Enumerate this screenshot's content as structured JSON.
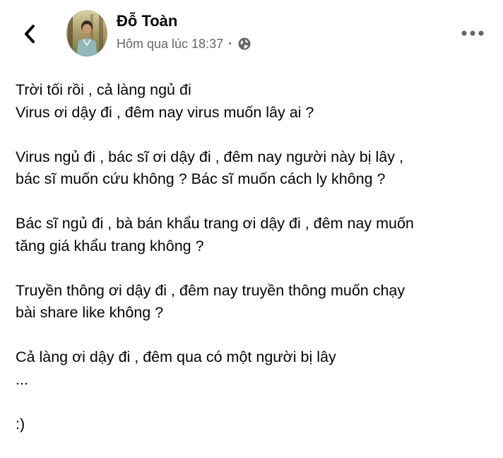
{
  "post": {
    "author": "Đỗ Toàn",
    "timestamp": "Hôm qua lúc 18:37",
    "separator": "·",
    "privacy_icon": "globe-icon",
    "back_icon": "chevron-left-icon",
    "more_icon": "more-horizontal-icon"
  },
  "body": {
    "p1": [
      "Trời tối rồi , cả làng ngủ đi",
      "Virus ơi dậy đi , đêm nay virus muốn lây ai ?"
    ],
    "p2": [
      "Virus ngủ đi , bác sĩ ơi dậy đi , đêm nay người này bị lây ,",
      "bác sĩ muốn cứu không ? Bác sĩ muốn cách ly không ?"
    ],
    "p3": [
      "Bác sĩ ngủ đi , bà bán khẩu trang ơi dậy đi , đêm nay muốn",
      "tăng giá khẩu trang không ?"
    ],
    "p4": [
      "Truyền thông ơi dậy đi , đêm nay truyền thông muốn chạy",
      "bài share like không ?"
    ],
    "p5": [
      "Cả làng ơi dậy đi , đêm qua có một người bị lây",
      "..."
    ],
    "p6": [
      ":)"
    ]
  },
  "colors": {
    "text": "#050505",
    "secondary_text": "#65676b",
    "background": "#ffffff"
  }
}
